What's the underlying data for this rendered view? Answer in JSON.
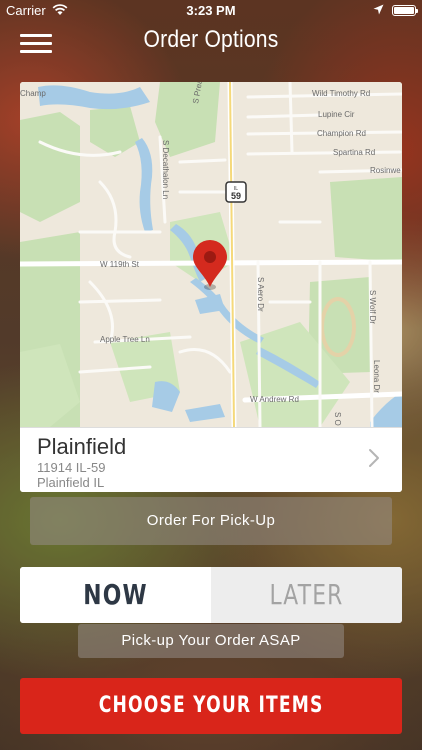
{
  "status_bar": {
    "carrier": "Carrier",
    "time": "3:23 PM"
  },
  "nav": {
    "title": "Order Options",
    "menu_icon": "hamburger-menu-icon"
  },
  "map": {
    "labels": {
      "wild_timothy": "Wild Timothy Rd",
      "lupine": "Lupine Cir",
      "champion": "Champion Rd",
      "spartina": "Spartina Rd",
      "rosinweed": "Rosinwe",
      "s_preak": "S Preak",
      "s_decathalon": "S Decathalon Ln",
      "highway": "59",
      "hwy_state": "IL",
      "w_119th": "W 119th St",
      "s_aero": "S Aero Dr",
      "s_wolf": "S Wolf Dr",
      "apple_tree": "Apple Tree Ln",
      "leona": "Leona Dr",
      "w_andrew": "W Andrew Rd",
      "s_o": "S O",
      "champ": "Champ"
    },
    "pin_color": "#d42a1e"
  },
  "location": {
    "name": "Plainfield",
    "address_line1": "11914 IL-59",
    "address_line2": "Plainfield IL"
  },
  "order_type": {
    "label": "Order For Pick-Up"
  },
  "timing": {
    "now_label": "NOW",
    "later_label": "LATER",
    "selected": "NOW",
    "hint": "Pick-up Your Order ASAP"
  },
  "cta": {
    "label": "CHOOSE YOUR ITEMS",
    "color": "#d9251a"
  }
}
